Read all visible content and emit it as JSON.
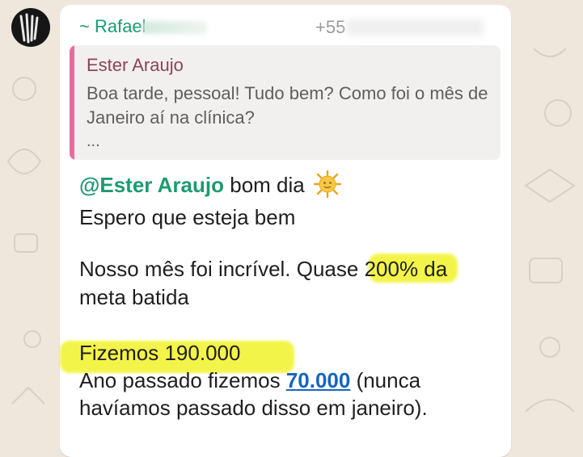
{
  "chat": {
    "avatar_icon": "profile-avatar",
    "message": {
      "sender_name": "~ Rafael",
      "sender_phone": "+55",
      "quote": {
        "author": "Ester Araujo",
        "text": "Boa tarde, pessoal! Tudo bem? Como foi o mês de Janeiro aí na clínica?",
        "ellipsis": "..."
      },
      "mention": "@Ester Araujo",
      "greeting": "bom dia",
      "emoji": "sun-with-face-icon",
      "line2": "Espero que esteja bem",
      "line3_prefix": "Nosso mês foi incrível. Qua",
      "line3_highlight": "se 200%",
      "line3_suffix": " da",
      "line4": "meta batida",
      "line5": "Fizemos 190.000",
      "line6_prefix": "Ano passado fizemos ",
      "line6_link": "70.000",
      "line6_suffix": " (nunca",
      "line7": "havíamos passado disso em janeiro)."
    }
  },
  "colors": {
    "background": "#efe7dc",
    "bubble": "#ffffff",
    "sender_green": "#1c9b70",
    "quote_bar": "#e46da0",
    "quote_author": "#8a4359",
    "highlight": "#f2f32a",
    "link": "#1565c0"
  }
}
